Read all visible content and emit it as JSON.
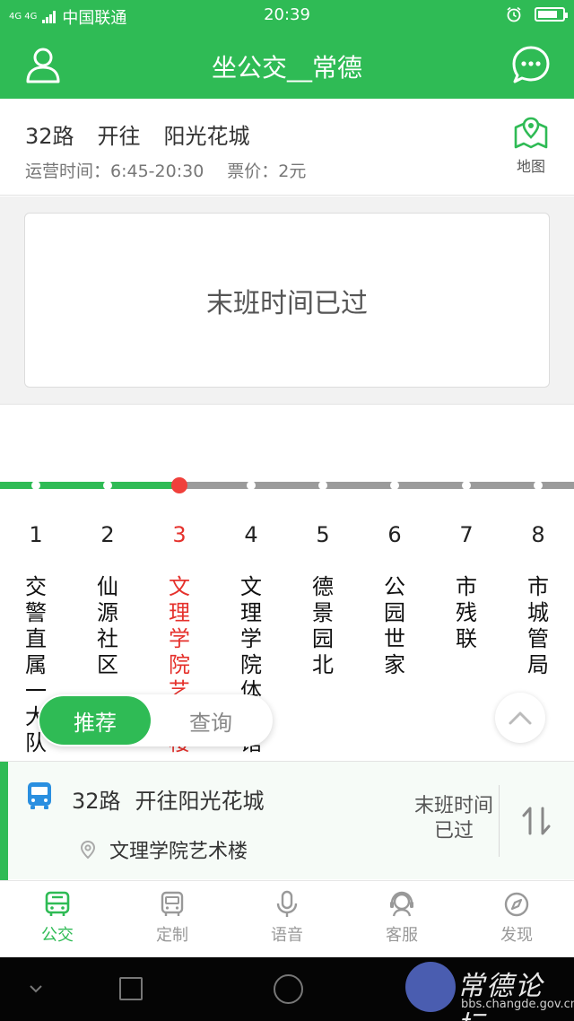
{
  "status_bar": {
    "network": "4G 4G",
    "carrier": "中国联通",
    "time": "20:39"
  },
  "header": {
    "title": "坐公交__常德",
    "left_icon": "user-icon",
    "right_icon": "message-icon"
  },
  "route": {
    "name": "32路",
    "direction_label": "开往",
    "destination": "阳光花城",
    "hours": "运营时间：6:45-20:30",
    "fare": "票价：2元",
    "map_label": "地图"
  },
  "notice": "末班时间已过",
  "stops": [
    {
      "num": "1",
      "name": "交警直属一大队"
    },
    {
      "num": "2",
      "name": "仙源社区"
    },
    {
      "num": "3",
      "name": "文理学院艺术楼"
    },
    {
      "num": "4",
      "name": "文理学院体育馆"
    },
    {
      "num": "5",
      "name": "德景园北"
    },
    {
      "num": "6",
      "name": "公园世家"
    },
    {
      "num": "7",
      "name": "市残联"
    },
    {
      "num": "8",
      "name": "市城管局"
    }
  ],
  "current_stop_index": 2,
  "toggle": {
    "recommend": "推荐",
    "query": "查询"
  },
  "route_card": {
    "route": "32路",
    "heading": "开往阳光花城",
    "stop": "文理学院艺术楼",
    "status": "末班时间已过"
  },
  "tabs": [
    {
      "label": "公交",
      "icon": "bus-icon"
    },
    {
      "label": "定制",
      "icon": "custom-bus-icon"
    },
    {
      "label": "语音",
      "icon": "microphone-icon"
    },
    {
      "label": "客服",
      "icon": "headset-icon"
    },
    {
      "label": "发现",
      "icon": "compass-icon"
    }
  ],
  "active_tab": 0,
  "watermark": {
    "title": "常德论坛",
    "url": "bbs.changde.gov.cn"
  },
  "colors": {
    "brand_green": "#2fbb55",
    "current_red": "#e5312c",
    "track_gray": "#9b9b9b"
  }
}
